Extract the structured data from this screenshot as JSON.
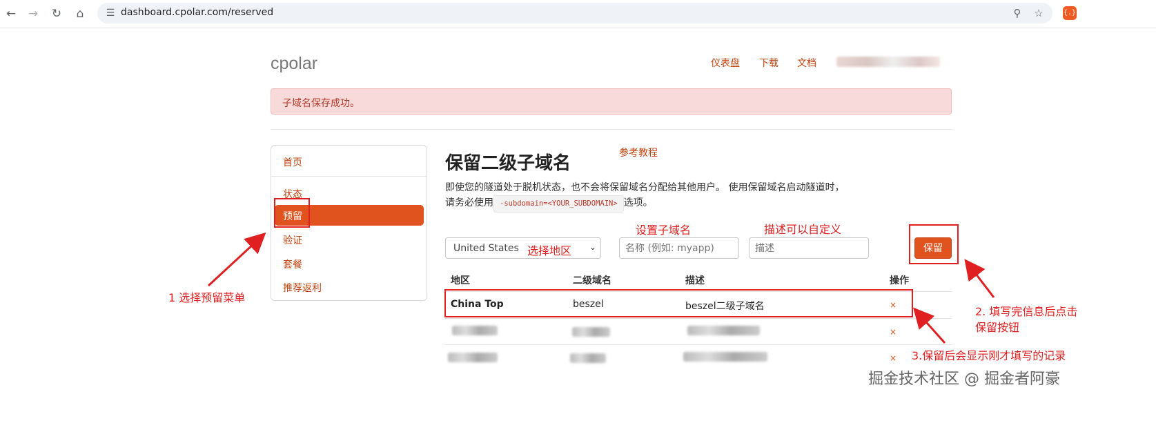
{
  "browser": {
    "url": "dashboard.cpolar.com/reserved",
    "icons": [
      "back-icon",
      "forward-icon",
      "reload-icon",
      "home-icon",
      "site-info-icon",
      "zoom-icon",
      "bookmark-star-icon",
      "extension-icon"
    ]
  },
  "site": {
    "logo": "cpolar",
    "nav": [
      "仪表盘",
      "下载",
      "文档"
    ]
  },
  "alert": {
    "message": "子域名保存成功。"
  },
  "sidebar": {
    "items": [
      "首页",
      "状态",
      "预留",
      "验证",
      "套餐",
      "推荐返利"
    ],
    "active": "预留"
  },
  "main": {
    "title": "保留二级子域名",
    "ref_link": "参考教程",
    "desc_part1": "即使您的隧道处于脱机状态，也不会将保留域名分配给其他用户。 使用保留域名启动隧道时，请务必使用",
    "desc_code": "-subdomain=<YOUR_SUBDOMAIN>",
    "desc_part2": "选项。",
    "region_value": "United States",
    "subdomain_placeholder": "名称 (例如: myapp)",
    "description_placeholder": "描述",
    "save_label": "保留"
  },
  "table": {
    "headers": [
      "地区",
      "二级域名",
      "描述",
      "操作"
    ],
    "rows": [
      {
        "region": "China Top",
        "subdomain": "beszel",
        "description": "beszel二级子域名",
        "action": "×"
      }
    ],
    "delete_symbol": "×"
  },
  "annotations": {
    "select_region": "选择地区",
    "set_subdomain": "设置子域名",
    "desc_custom": "描述可以自定义",
    "step1": "1 选择预留菜单",
    "step2_line1": "2. 填写完信息后点击",
    "step2_line2": "保留按钮",
    "step3": "3.保留后会显示刚才填写的记录",
    "color": "#e02020"
  },
  "watermark": "掘金技术社区 @ 掘金者阿豪",
  "colors": {
    "accent": "#e0531f",
    "link": "#c2410c",
    "alert_bg": "#f8dada"
  }
}
